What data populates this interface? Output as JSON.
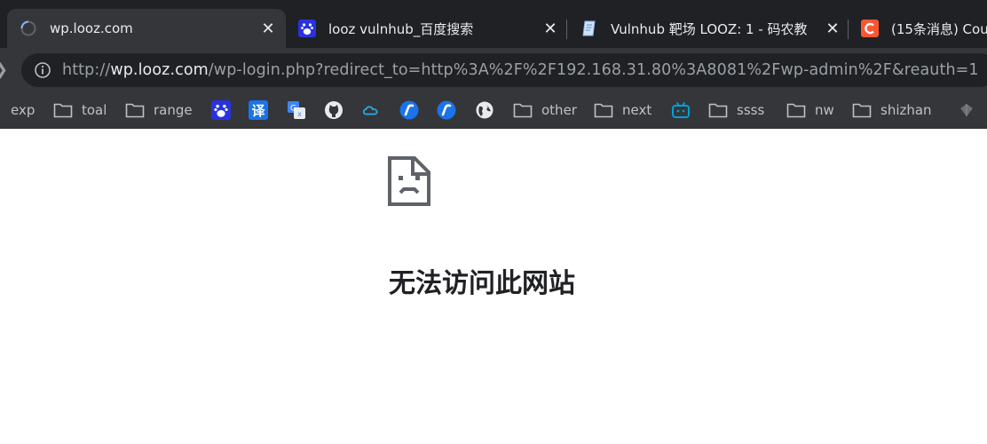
{
  "tabs": [
    {
      "title": "wp.looz.com",
      "favicon": "loading-spinner-icon",
      "active": true
    },
    {
      "title": "looz vulnhub_百度搜索",
      "favicon": "baidu-paw-icon",
      "active": false
    },
    {
      "title": "Vulnhub 靶场 LOOZ: 1 - 码农教",
      "favicon": "document-pen-icon",
      "active": false
    },
    {
      "title": "(15条消息) Cou",
      "favicon": "csdn-c-icon",
      "active": false
    }
  ],
  "close_glyph": "✕",
  "omnibox": {
    "scheme": "http://",
    "host": "wp.looz.com",
    "path": "/wp-login.php?redirect_to=http%3A%2F%2F192.168.31.80%3A8081%2Fwp-admin%2F&reauth=1"
  },
  "bookmarks": [
    {
      "label": "exp",
      "icon": "folder-icon"
    },
    {
      "label": "toal",
      "icon": "folder-icon"
    },
    {
      "label": "range",
      "icon": "folder-icon"
    },
    {
      "label": "",
      "icon": "baidu-paw-icon"
    },
    {
      "label": "",
      "icon": "translate-icon",
      "glyph": "译"
    },
    {
      "label": "",
      "icon": "google-translate-icon"
    },
    {
      "label": "",
      "icon": "github-icon"
    },
    {
      "label": "",
      "icon": "cloud-icon"
    },
    {
      "label": "",
      "icon": "fofa-icon"
    },
    {
      "label": "",
      "icon": "fofa-icon"
    },
    {
      "label": "",
      "icon": "globe-icon"
    },
    {
      "label": "other",
      "icon": "folder-icon"
    },
    {
      "label": "next",
      "icon": "folder-icon"
    },
    {
      "label": "",
      "icon": "bilibili-tv-icon"
    },
    {
      "label": "ssss",
      "icon": "folder-icon"
    },
    {
      "label": "nw",
      "icon": "folder-icon"
    },
    {
      "label": "shizhan",
      "icon": "folder-icon"
    }
  ],
  "error": {
    "icon": "sad-document-icon",
    "heading": "无法访问此网站"
  },
  "colors": {
    "tabstrip_bg": "#202124",
    "toolbar_bg": "#35363a",
    "accent_blue": "#1a73e8",
    "csdn_red": "#fc5531"
  }
}
